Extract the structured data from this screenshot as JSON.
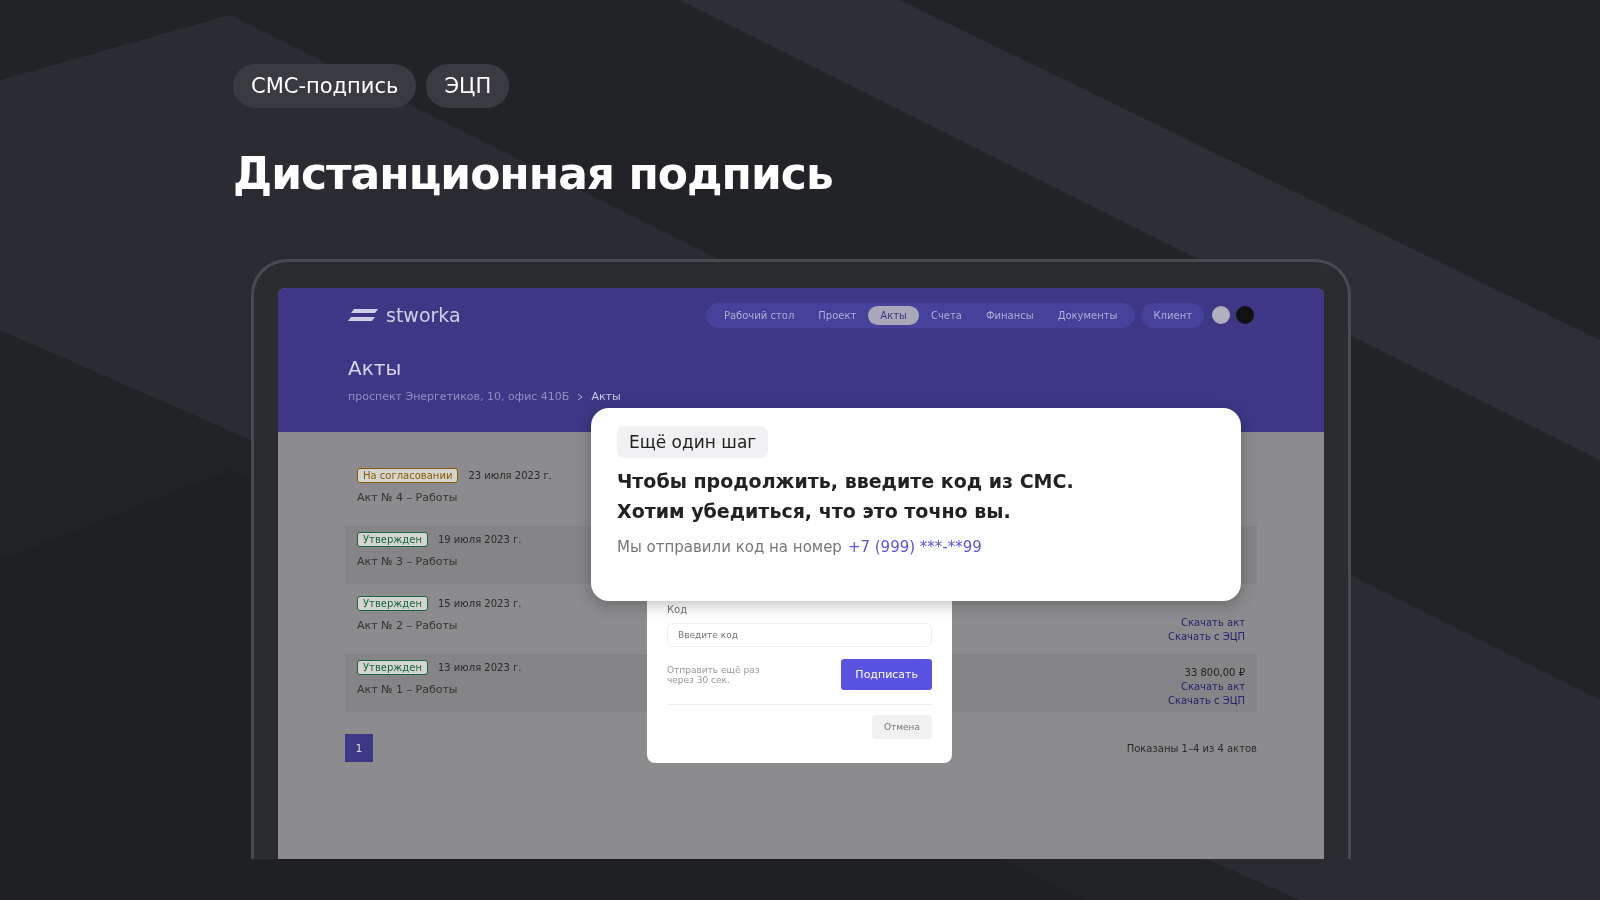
{
  "chips": [
    {
      "label": "СМС-подпись"
    },
    {
      "label": "ЭЦП"
    }
  ],
  "title": "Дистанционная подпись",
  "app": {
    "logo": "stworka",
    "nav": [
      {
        "label": "Рабочий стол",
        "selected": false
      },
      {
        "label": "Проект",
        "selected": false
      },
      {
        "label": "Акты",
        "selected": true
      },
      {
        "label": "Счета",
        "selected": false
      },
      {
        "label": "Финансы",
        "selected": false
      },
      {
        "label": "Документы",
        "selected": false
      }
    ],
    "client": "Клиент",
    "page_title": "Акты",
    "breadcrumb": [
      "проспект Энергетиков, 10, офис 410Б",
      "Акты"
    ],
    "rows": [
      {
        "status": "На согласовании",
        "color": "#8a5a00",
        "date": "23 июля 2023 г.",
        "name": "Акт № 4 – Работы"
      },
      {
        "status": "Утвержден",
        "color": "#17663f",
        "date": "19 июля 2023 г.",
        "name": "Акт № 3 – Работы"
      },
      {
        "status": "Утвержден",
        "color": "#17663f",
        "date": "15 июля 2023 г.",
        "name": "Акт № 2 – Работы",
        "links": [
          "Скачать акт",
          "Скачать с ЭЦП"
        ]
      },
      {
        "status": "Утвержден",
        "color": "#17663f",
        "date": "13 июля 2023 г.",
        "name": "Акт № 1 – Работы",
        "amount": "33 800,00 ₽",
        "links": [
          "Скачать акт",
          "Скачать с ЭЦП"
        ]
      }
    ],
    "pages": [
      {
        "label": "1",
        "selected": true
      }
    ],
    "footer": "Показаны 1–4 из 4 актов",
    "modal": {
      "field_label": "Код",
      "placeholder": "Введите код",
      "resend": "Отправить ещё раз через 30 сек.",
      "sign": "Подписать",
      "cancel": "Отмена"
    }
  },
  "callout": {
    "tag": "Ещё один шаг",
    "lines": [
      "Чтобы продолжить, введите код из СМС.",
      "Хотим убедиться, что это точно вы."
    ],
    "note": "Мы отправили код на номер",
    "phone": "+7 (999) ***-**99"
  }
}
